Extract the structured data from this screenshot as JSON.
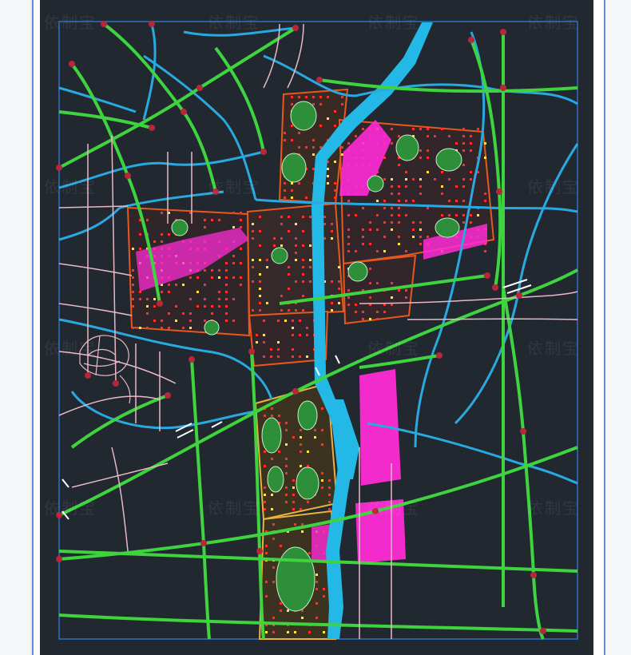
{
  "map": {
    "type": "cad-urban-master-plan",
    "background_color": "#212830",
    "colors": {
      "main_road": "#3fd43f",
      "water": "#24b8e6",
      "secondary_road": "#29a9e0",
      "local_road": "#e9b8c4",
      "commercial_parcel": "#ff2bd6",
      "residential_parcel": "#e8581c",
      "residential_lot": "#ff2f2f",
      "greenspace": "#2e8f3a",
      "node": "#b8263a",
      "plan_boundary": "#2f6fc8"
    },
    "legend": []
  },
  "watermark": {
    "text": "依制宝"
  }
}
